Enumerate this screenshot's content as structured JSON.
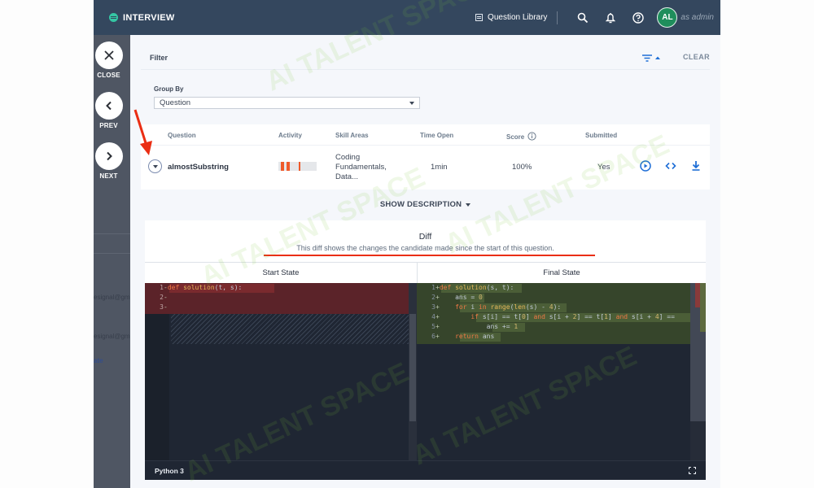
{
  "app": {
    "title": "INTERVIEW",
    "question_library": "Question Library",
    "avatar_initials": "AL",
    "as_admin": "as admin"
  },
  "sidenav": {
    "close": "CLOSE",
    "prev": "PREV",
    "next": "NEXT",
    "bg_text_1": "esignal@gm",
    "bg_text_2": "esignal@gm",
    "bg_text_3": "ate"
  },
  "filter": {
    "title": "Filter",
    "clear": "CLEAR",
    "group_by_label": "Group By",
    "group_by_value": "Question"
  },
  "table": {
    "headers": {
      "question": "Question",
      "activity": "Activity",
      "skill_areas": "Skill Areas",
      "time_open": "Time Open",
      "score": "Score",
      "submitted": "Submitted"
    },
    "rows": [
      {
        "question": "almostSubstring",
        "skill_areas": [
          "Coding",
          "Fundamentals,",
          "Data..."
        ],
        "time_open": "1min",
        "score": "100%",
        "submitted": "Yes"
      }
    ]
  },
  "show_description": "SHOW DESCRIPTION",
  "diff": {
    "title": "Diff",
    "subtitle": "This diff shows the changes the candidate made since the start of this question.",
    "start_state": "Start State",
    "final_state": "Final State",
    "language": "Python 3"
  },
  "code": {
    "start": [
      {
        "n": "1",
        "mark": "-",
        "text": "def solution(t, s):"
      },
      {
        "n": "2",
        "mark": "-",
        "text": ""
      },
      {
        "n": "3",
        "mark": "-",
        "text": ""
      }
    ],
    "final": [
      {
        "n": "1",
        "mark": "+",
        "text": "def solution(s, t):"
      },
      {
        "n": "2",
        "mark": "+",
        "text": "    ans = 0"
      },
      {
        "n": "3",
        "mark": "+",
        "text": "    for i in range(len(s) - 4):"
      },
      {
        "n": "4",
        "mark": "+",
        "text": "        if s[i] == t[0] and s[i + 2] == t[1] and s[i + 4] =="
      },
      {
        "n": "5",
        "mark": "+",
        "text": "            ans += 1"
      },
      {
        "n": "6",
        "mark": "+",
        "text": "    return ans"
      }
    ]
  },
  "watermark": "AI TALENT SPACE",
  "colors": {
    "topbar": "#34475e",
    "accent_link": "#1e6ed6",
    "annotation_red": "#ea2e14",
    "avatar_green": "#1f8e5c"
  }
}
